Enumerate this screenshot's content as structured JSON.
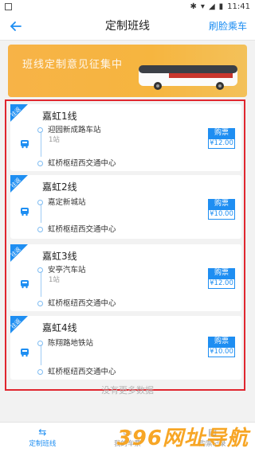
{
  "status_bar": {
    "time": "11:41"
  },
  "nav": {
    "title": "定制班线",
    "action": "刷脸乘车"
  },
  "banner": {
    "text": "班线定制意见征集中"
  },
  "routes": [
    {
      "tag": "往返",
      "name": "嘉虹1线",
      "from": "迎园新成路车站",
      "count": "1站",
      "to": "虹桥枢纽西交通中心",
      "buy": "购票",
      "price": "¥12.00"
    },
    {
      "tag": "往返",
      "name": "嘉虹2线",
      "from": "嘉定新城站",
      "count": "",
      "to": "虹桥枢纽西交通中心",
      "buy": "购票",
      "price": "¥10.00"
    },
    {
      "tag": "往返",
      "name": "嘉虹3线",
      "from": "安亭汽车站",
      "count": "1站",
      "to": "虹桥枢纽西交通中心",
      "buy": "购票",
      "price": "¥12.00"
    },
    {
      "tag": "往返",
      "name": "嘉虹4线",
      "from": "陈翔路地铁站",
      "count": "",
      "to": "虹桥枢纽西交通中心",
      "buy": "购票",
      "price": "¥10.00"
    }
  ],
  "list_footer": "没有更多数据",
  "tabs": [
    {
      "label": "定制班线",
      "icon": "swap-icon"
    },
    {
      "label": "我的车票",
      "icon": "ticket-icon"
    },
    {
      "label": "购票记录",
      "icon": "record-icon"
    }
  ],
  "watermark": "396网址导航",
  "colors": {
    "accent": "#1e8ef2",
    "highlight_border": "#e0262f",
    "banner": "#f6b53f"
  }
}
